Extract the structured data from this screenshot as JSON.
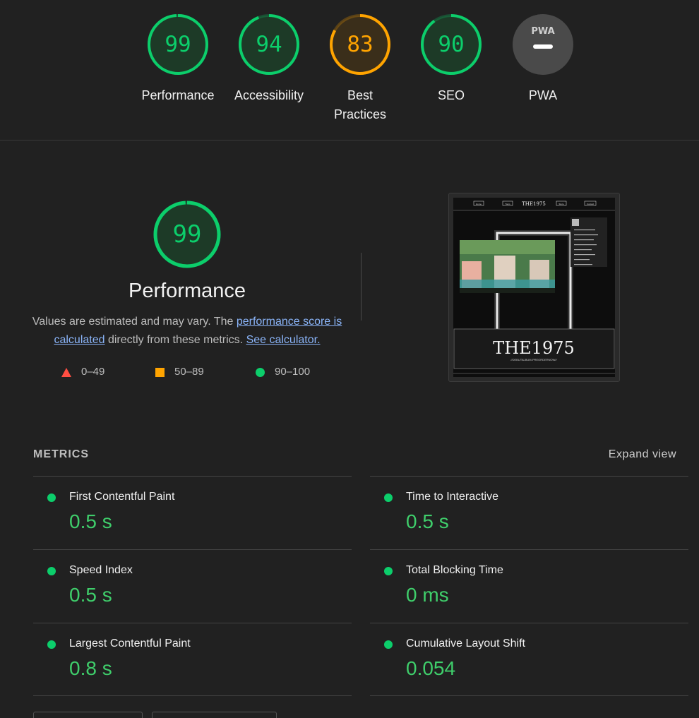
{
  "categories": [
    {
      "score": "99",
      "label": "Performance",
      "value": 0.99,
      "color": "#0cce6b"
    },
    {
      "score": "94",
      "label": "Accessibility",
      "value": 0.94,
      "color": "#0cce6b"
    },
    {
      "score": "83",
      "label": "Best Practices",
      "value": 0.83,
      "color": "#ffa400"
    },
    {
      "score": "90",
      "label": "SEO",
      "value": 0.9,
      "color": "#0cce6b"
    },
    {
      "score": "",
      "label": "PWA",
      "badge": "PWA",
      "color": "#5f5f5f"
    }
  ],
  "performance": {
    "score": "99",
    "value": 0.99,
    "title": "Performance",
    "desc_prefix": "Values are estimated and may vary. The ",
    "desc_link": "performance score is calculated",
    "desc_middle": " directly from these metrics. ",
    "calc_link": "See calculator.",
    "legend": [
      "0–49",
      "50–89",
      "90–100"
    ]
  },
  "screenshot": {
    "nav_items": [
      "Home",
      "Tours",
      "Store",
      "Contact"
    ],
    "logo": "THE1975",
    "banner_logo": "THE1975",
    "banner_sub": "//DEBUTALBUM-PREORDERNOW//"
  },
  "metrics": {
    "heading": "METRICS",
    "expand_label": "Expand view",
    "items": [
      {
        "title": "First Contentful Paint",
        "value": "0.5 s"
      },
      {
        "title": "Time to Interactive",
        "value": "0.5 s"
      },
      {
        "title": "Speed Index",
        "value": "0.5 s"
      },
      {
        "title": "Total Blocking Time",
        "value": "0 ms"
      },
      {
        "title": "Largest Contentful Paint",
        "value": "0.8 s"
      },
      {
        "title": "Cumulative Layout Shift",
        "value": "0.054"
      }
    ]
  },
  "colors": {
    "pass": "#0cce6b",
    "average": "#ffa400",
    "fail": "#ff4e42",
    "value_text": "#3fce6b"
  }
}
